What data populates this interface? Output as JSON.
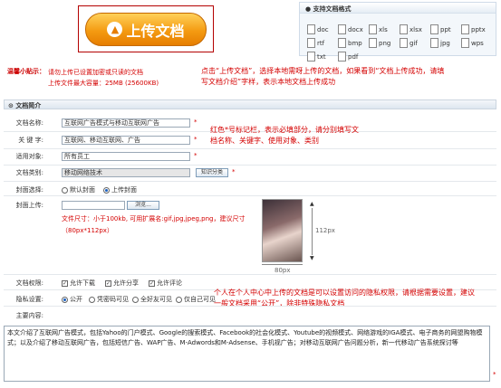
{
  "upload": {
    "button_label": "上传文档"
  },
  "formats": {
    "title": "支持文档格式",
    "items": [
      "doc",
      "docx",
      "xls",
      "xlsx",
      "ppt",
      "pptx",
      "rtf",
      "bmp",
      "png",
      "gif",
      "jpg",
      "wps",
      "txt",
      "pdf"
    ]
  },
  "tips": {
    "label": "温馨小贴示：",
    "line1": "请勿上传已设置加密或只读的文档",
    "line2": "上传文件最大容量：25MB (25600KB)"
  },
  "annotations": {
    "upload_note": "点击“上传文档”，选择本地需呀上传的文档，如果看到“文档上传成功，请填写文档介绍”字样，表示本地文档上传成功",
    "required_note": "红色*号标记栏，表示必填部分，请分别填写文档名称、关键字、使用对象、类别",
    "privacy_note": "个人在个人中心中上传的文档是可以设置访问的隐私权限，请根据需要设置，建议一般文档采用“公开”，除非特殊隐私文档"
  },
  "section": {
    "title": "文档简介"
  },
  "form": {
    "doc_name": {
      "label": "文档名称:",
      "value": "互联网广告模式与移动互联网广告"
    },
    "keywords": {
      "label": "关 键 字:",
      "value": "互联网、移动互联网、广告"
    },
    "audience": {
      "label": "适用对象:",
      "value": "所有员工"
    },
    "category": {
      "label": "文档类别:",
      "value": "移动网络技术",
      "button": "知识分类"
    },
    "cover": {
      "label": "封面选择:",
      "options": [
        "默认封面",
        "上传封面"
      ],
      "selected": 1
    },
    "cover_upload": {
      "label": "封面上传:",
      "browse": "浏览...",
      "hint1": "文件尺寸：小于100kb, 可用扩展名:gif,jpg,jpeg,png，建议尺寸",
      "hint2": "（80px*112px）",
      "width_label": "80px",
      "height_label": "112px"
    },
    "permissions": {
      "label": "文档权限:",
      "items": [
        "允许下载",
        "允许分享",
        "允许评论"
      ]
    },
    "privacy": {
      "label": "隐私设置:",
      "options": [
        "公开",
        "凭密码可见",
        "全好友可见",
        "仅自己可见"
      ],
      "selected": 0
    },
    "content": {
      "label": "主要内容:",
      "value": "本文介绍了互联网广告模式，包括Yahoo的门户模式、Google的搜索模式、Facebook的社会化模式、Youtube的视频模式、网络游戏的IGA模式、电子商务的网盟购物模式；以及介绍了移动互联网广告，包括短信广告、WAP广告、M-Adwords和M-Adsense、手机视广告；对移动互联网广告问题分析，新一代移动广告系统探讨等"
    }
  }
}
